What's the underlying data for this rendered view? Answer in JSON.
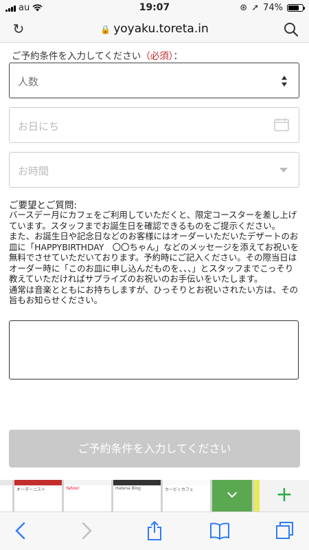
{
  "status_bar": {
    "carrier": "au",
    "time": "19:07",
    "battery": "74%",
    "battery_level": 0.74
  },
  "browser": {
    "url": "yoyaku.toreta.in",
    "icons": [
      "reload-icon",
      "lock-icon",
      "search-icon"
    ]
  },
  "form": {
    "conditions_label": "ご予約条件を入力してください",
    "required_label": "（必須）",
    "colon": "：",
    "party_size_placeholder": "人数",
    "date_placeholder": "お日にち",
    "time_placeholder": "お時間",
    "request_title": "ご要望とご質問:",
    "request_paragraphs": [
      "バースデー月にカフェをご利用していただくと、限定コースターを差し上げています。スタッフまでお誕生日を確認できるものをご提示ください。",
      "また、お誕生日や記念日などのお客様にはオーダーいただいたデザートのお皿に「HAPPYBIRTHDAY　〇〇ちゃん」などのメッセージを添えてお祝いを無料でさせていただいております。予約時にご記入ください。その際当日はオーダー時に「このお皿に申し込んだものを、、、」とスタッフまでこっそり教えていただければサプライズのお祝いのお手伝いをいたします。",
      "通常は音楽とともにお持ちしますが、ひっそりとお祝いされたい方は、その旨もお知らせください。"
    ],
    "submit_label": "ご予約条件を入力してください"
  },
  "tabs": {
    "thumbnails": [
      "オーダーニスト",
      "Yahoo!",
      "Hatena Blog",
      "カービィカフェ",
      "",
      ""
    ],
    "new_tab_label": "+"
  },
  "toolbar": {
    "icons": [
      "back-icon",
      "forward-icon",
      "share-icon",
      "bookmarks-icon",
      "tabs-icon"
    ]
  },
  "colors": {
    "accent": "#2f7bf6",
    "required": "#c62828",
    "submit_disabled": "#c9c9c9",
    "new_tab_green": "#2ea84b"
  }
}
